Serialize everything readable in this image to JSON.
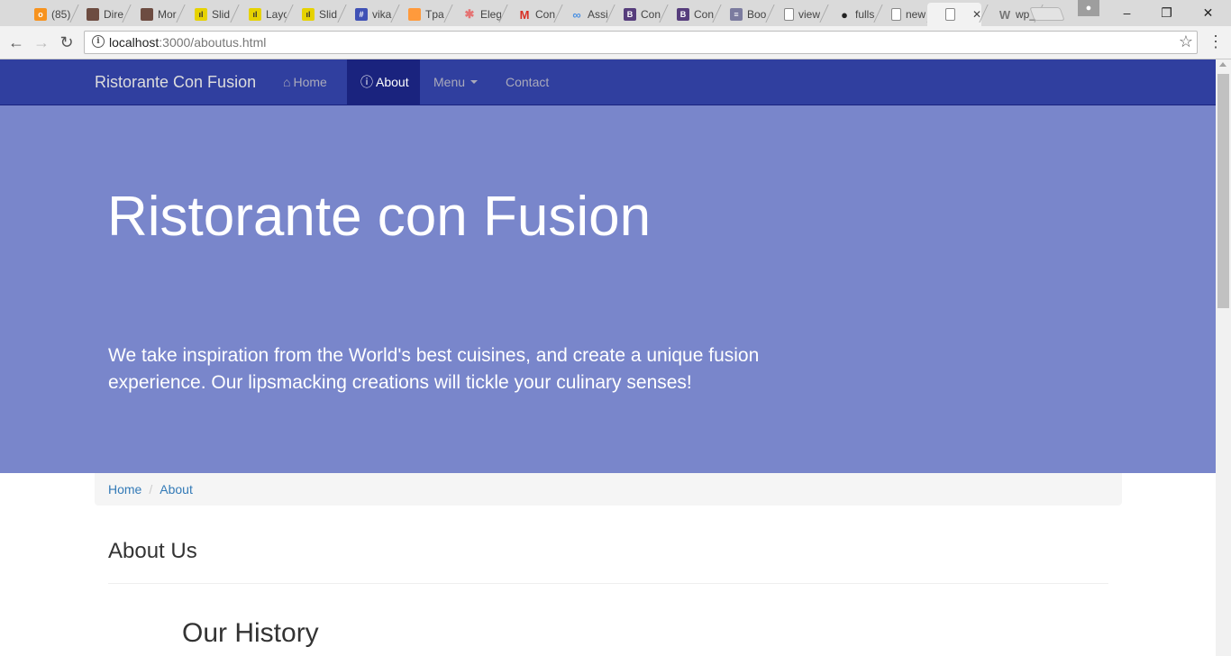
{
  "browser": {
    "tabs": [
      {
        "label": "(85)",
        "icon": "odnoklassniki-icon",
        "color": "#f7931e"
      },
      {
        "label": "Dire",
        "icon": "photo-icon",
        "color": "#6d4c41"
      },
      {
        "label": "Mor",
        "icon": "photo-icon",
        "color": "#6d4c41"
      },
      {
        "label": "Slid",
        "icon": "chart-icon",
        "color": "#e6d200"
      },
      {
        "label": "Layo",
        "icon": "chart-icon",
        "color": "#e6d200"
      },
      {
        "label": "Slid",
        "icon": "chart-icon",
        "color": "#e6d200"
      },
      {
        "label": "vika",
        "icon": "grid-icon",
        "color": "#3f51b5"
      },
      {
        "label": "Tpa",
        "icon": "square-icon",
        "color": "#ff9a3c"
      },
      {
        "label": "Eleg",
        "icon": "asterisk-icon",
        "color": "#e57373"
      },
      {
        "label": "Con",
        "icon": "gmail-icon",
        "color": "#d93025"
      },
      {
        "label": "Assi",
        "icon": "infinity-icon",
        "color": "#4a90e2"
      },
      {
        "label": "Con",
        "icon": "bootstrap-icon",
        "color": "#563d7c"
      },
      {
        "label": "Con",
        "icon": "bootstrap-icon",
        "color": "#563d7c"
      },
      {
        "label": "Boo",
        "icon": "document-icon",
        "color": "#7b7b9f"
      },
      {
        "label": "view",
        "icon": "file-icon",
        "color": "#888888"
      },
      {
        "label": "fulls",
        "icon": "github-icon",
        "color": "#222222"
      },
      {
        "label": "new",
        "icon": "file-icon",
        "color": "#888888"
      },
      {
        "label": "",
        "icon": "file-icon",
        "color": "#888888",
        "active": true
      },
      {
        "label": "wp_",
        "icon": "wordpress-icon",
        "color": "#777777"
      }
    ],
    "url_host": "localhost",
    "url_path": ":3000/aboutus.html"
  },
  "navbar": {
    "brand": "Ristorante Con Fusion",
    "items": [
      {
        "label": "Home",
        "icon": "home-icon"
      },
      {
        "label": "About",
        "icon": "info-icon",
        "active": true
      },
      {
        "label": "Menu",
        "icon": "caret-icon"
      },
      {
        "label": "Contact"
      }
    ],
    "color": "#303f9f",
    "active_color": "#1a237e"
  },
  "jumbotron": {
    "title": "Ristorante con Fusion",
    "text": "We take inspiration from the World's best cuisines, and create a unique fusion experience. Our lipsmacking creations will tickle your culinary senses!",
    "color": "#7986cb"
  },
  "breadcrumb": {
    "items": [
      "Home",
      "About"
    ],
    "separator": "/"
  },
  "content": {
    "heading": "About Us",
    "subheading": "Our History"
  }
}
